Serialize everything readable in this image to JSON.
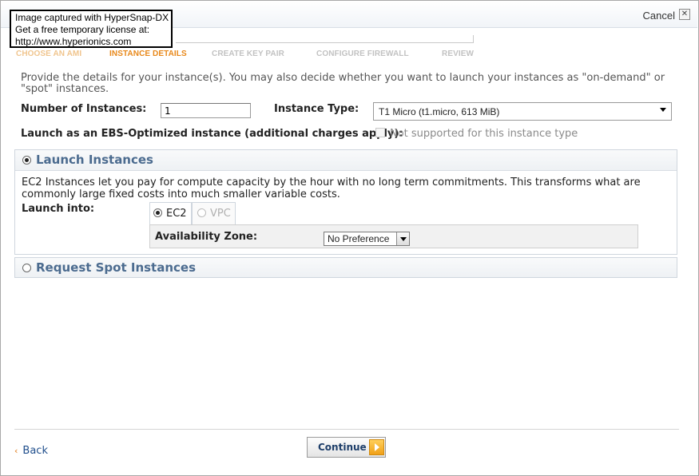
{
  "watermark": {
    "line1": "Image captured with HyperSnap-DX",
    "line2": "Get a free temporary license at:",
    "line3": "http://www.hyperionics.com"
  },
  "header": {
    "cancel_label": "Cancel",
    "close_glyph": "✕"
  },
  "steps": [
    {
      "label": "CHOOSE AN AMI",
      "state": "done"
    },
    {
      "label": "INSTANCE DETAILS",
      "state": "active"
    },
    {
      "label": "CREATE KEY PAIR",
      "state": "pending"
    },
    {
      "label": "CONFIGURE FIREWALL",
      "state": "pending"
    },
    {
      "label": "REVIEW",
      "state": "pending"
    }
  ],
  "intro_text": "Provide the details for your instance(s). You may also decide whether you want to launch your instances as \"on-demand\" or \"spot\" instances.",
  "form": {
    "num_instances_label": "Number of Instances:",
    "num_instances_value": "1",
    "instance_type_label": "Instance Type:",
    "instance_type_value": "T1 Micro (t1.micro, 613 MiB)",
    "ebs_label": "Launch as an EBS-Optimized instance (additional charges apply):",
    "ebs_checked": false,
    "ebs_note": "Not supported for this instance type"
  },
  "launch_panel": {
    "title": "Launch Instances",
    "selected": true,
    "description": "EC2 Instances let you pay for compute capacity by the hour with no long term commitments. This transforms what are commonly large fixed costs into much smaller variable costs.",
    "launch_into_label": "Launch into:",
    "tabs": [
      {
        "label": "EC2",
        "selected": true,
        "enabled": true
      },
      {
        "label": "VPC",
        "selected": false,
        "enabled": false
      }
    ],
    "az_label": "Availability Zone:",
    "az_value": "No Preference"
  },
  "spot_panel": {
    "title": "Request Spot Instances",
    "selected": false
  },
  "footer": {
    "back_label": "Back",
    "back_chevron": "‹",
    "continue_label": "Continue"
  },
  "colors": {
    "step_active": "#e8881a",
    "step_done": "#f0c58e",
    "step_pending": "#c2c2c2",
    "panel_title": "#4b6b8f",
    "link": "#1f4e8c"
  }
}
